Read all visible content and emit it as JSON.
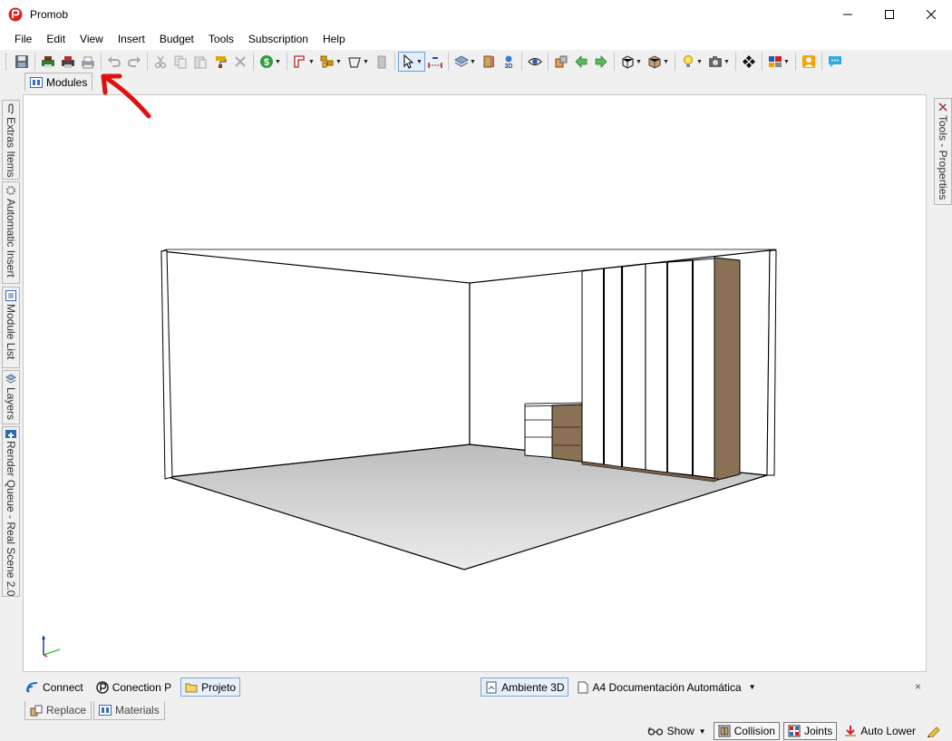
{
  "window": {
    "title": "Promob"
  },
  "menu": [
    "File",
    "Edit",
    "View",
    "Insert",
    "Budget",
    "Tools",
    "Subscription",
    "Help"
  ],
  "panels": {
    "top_tab": "Modules",
    "left_tabs": [
      "Extras Items",
      "Automatic Insert",
      "Module List",
      "Layers",
      "Render Queue - Real Scene 2.0"
    ],
    "right_tabs": [
      "Tools - Properties"
    ]
  },
  "document_bar": {
    "tabs": [
      "Connect",
      "Conection P",
      "Projeto"
    ],
    "views": [
      "Ambiente 3D",
      "A4 Documentación Automática"
    ],
    "close": "×"
  },
  "bottom_tabs": [
    "Replace",
    "Materials"
  ],
  "status": {
    "show": "Show",
    "collision": "Collision",
    "joints": "Joints",
    "auto_lower": "Auto Lower"
  },
  "colors": {
    "accent": "#1e6fc2",
    "annotation_arrow": "#e01010",
    "wood": "#8a7055"
  },
  "icons": [
    "save-icon",
    "print-icon",
    "print-preview-icon",
    "undo-icon",
    "redo-icon",
    "budget-icon",
    "select-arrow-icon",
    "eye-icon",
    "camera-icon",
    "user-icon",
    "chat-icon"
  ]
}
